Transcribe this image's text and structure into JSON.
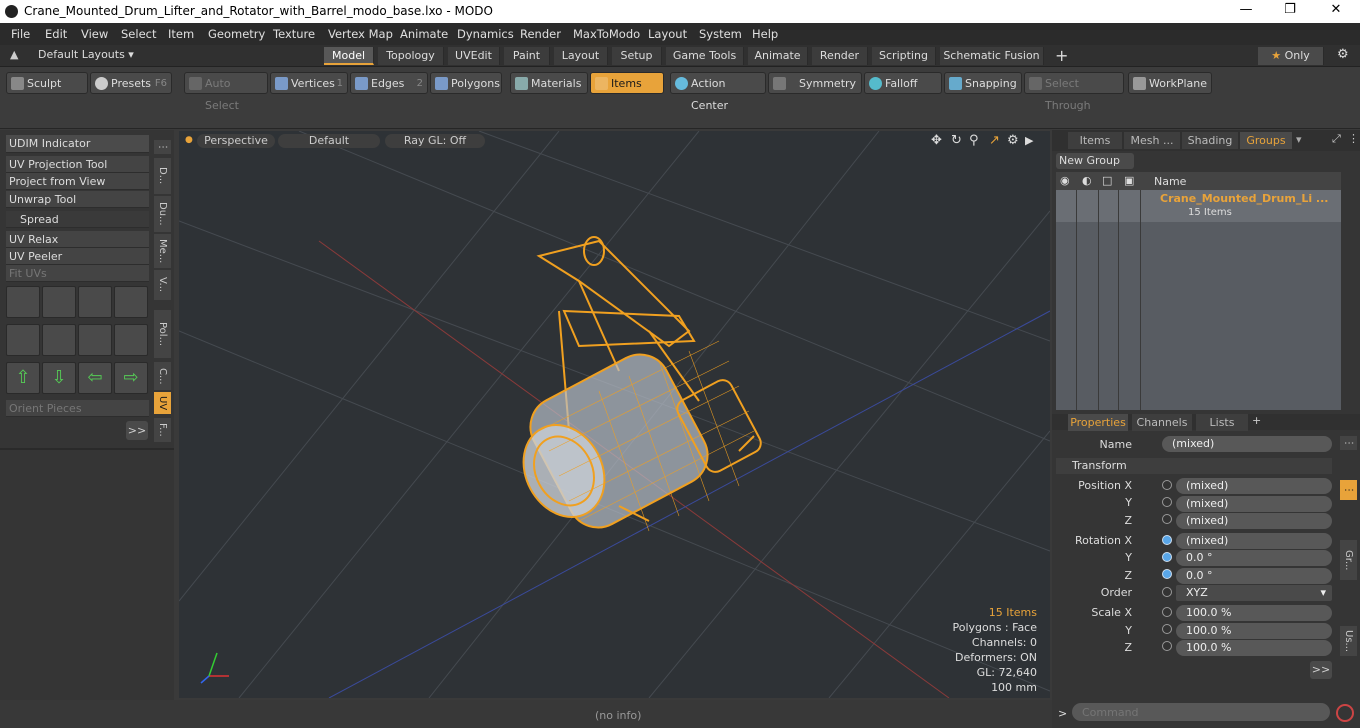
{
  "title": "Crane_Mounted_Drum_Lifter_and_Rotator_with_Barrel_modo_base.lxo - MODO",
  "menu": [
    "File",
    "Edit",
    "View",
    "Select",
    "Item",
    "Geometry",
    "Texture",
    "Vertex Map",
    "Animate",
    "Dynamics",
    "Render",
    "MaxToModo",
    "Layout",
    "System",
    "Help"
  ],
  "layout_selector": "Default Layouts ▾",
  "tabs": [
    "Model",
    "Topology",
    "UVEdit",
    "Paint",
    "Layout",
    "Setup",
    "Game Tools",
    "Animate",
    "Render",
    "Scripting",
    "Schematic Fusion"
  ],
  "only_label": "Only",
  "toolbar": {
    "sculpt": "Sculpt",
    "presets": "Presets",
    "presets_key": "F6",
    "auto_select": "Auto Select",
    "vertices": "Vertices",
    "vertices_key": "1",
    "edges": "Edges",
    "edges_key": "2",
    "polygons": "Polygons",
    "materials": "Materials",
    "items": "Items",
    "action_center": "Action Center",
    "symmetry": "Symmetry",
    "falloff": "Falloff",
    "snapping": "Snapping",
    "select_through": "Select Through",
    "workplane": "WorkPlane"
  },
  "left": {
    "udim": "UDIM Indicator",
    "uv_projection": "UV Projection Tool",
    "project_from_view": "Project from View",
    "unwrap": "Unwrap Tool",
    "spread": "Spread",
    "uv_relax": "UV Relax",
    "uv_peeler": "UV Peeler",
    "fit_uvs": "Fit UVs",
    "orient_pieces": "Orient Pieces",
    "more": ">>",
    "vtabs": [
      "D...",
      "Du...",
      "Me...",
      "V...",
      "Pol...",
      "C...",
      "UV",
      "F..."
    ]
  },
  "viewport": {
    "perspective": "Perspective",
    "default": "Default",
    "raygl": "Ray GL: Off",
    "info_items": "15 Items",
    "info_polygons": "Polygons : Face",
    "info_channels": "Channels: 0",
    "info_deformers": "Deformers: ON",
    "info_gl": "GL: 72,640",
    "info_mm": "100 mm"
  },
  "status": "(no info)",
  "right": {
    "tabs": [
      "Items",
      "Mesh ...",
      "Shading",
      "Groups"
    ],
    "new_group": "New Group",
    "name_col": "Name",
    "group_name": "Crane_Mounted_Drum_Li ...",
    "group_count": "15 Items",
    "prop_tabs": [
      "Properties",
      "Channels",
      "Lists"
    ],
    "name_label": "Name",
    "name_value": "(mixed)",
    "transform": "Transform",
    "pos_x_label": "Position X",
    "pos_x": "(mixed)",
    "pos_y": "(mixed)",
    "pos_z": "(mixed)",
    "rot_x_label": "Rotation X",
    "rot_x": "(mixed)",
    "rot_y": "0.0 °",
    "rot_z": "0.0 °",
    "order_label": "Order",
    "order_value": "XYZ",
    "scale_x_label": "Scale X",
    "scale_x": "100.0 %",
    "scale_y": "100.0 %",
    "scale_z": "100.0 %",
    "y": "Y",
    "z": "Z",
    "more": ">>",
    "side_gr": "Gr...",
    "side_us": "Us..."
  },
  "command_placeholder": "Command",
  "colors": {
    "accent": "#e8a33a",
    "viewport": "#2e3236",
    "wire": "#f0a020"
  }
}
